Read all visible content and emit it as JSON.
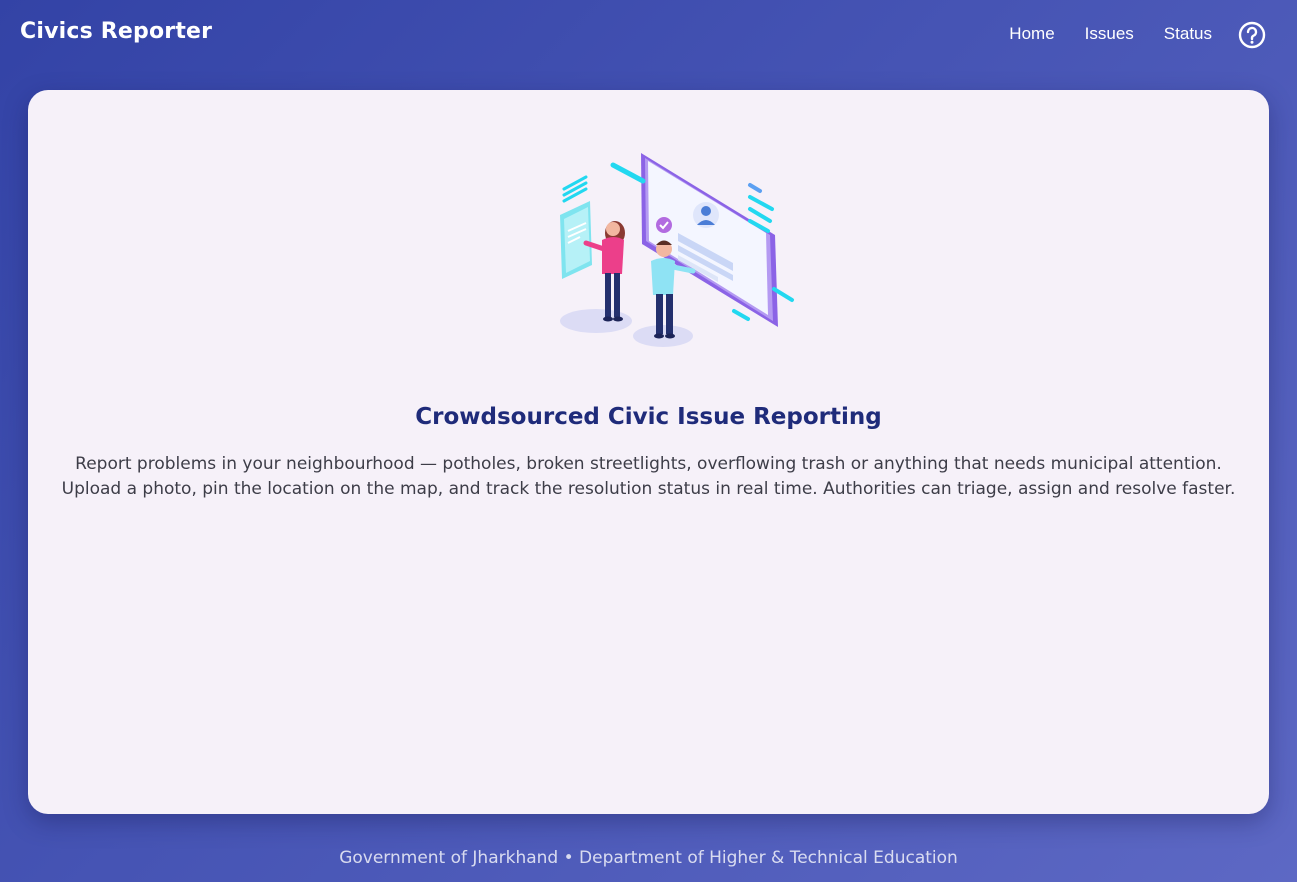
{
  "header": {
    "brand": "Civics Reporter",
    "nav": [
      {
        "label": "Home"
      },
      {
        "label": "Issues"
      },
      {
        "label": "Status"
      }
    ],
    "help_icon": "question-circle-icon"
  },
  "hero": {
    "illustration": "people-reporting-on-screen-illustration",
    "title": "Crowdsourced Civic Issue Reporting",
    "description": "Report problems in your neighbourhood — potholes, broken streetlights, overflowing trash or anything that needs municipal attention. Upload a photo, pin the location on the map, and track the resolution status in real time. Authorities can triage, assign and resolve faster."
  },
  "footer": {
    "text": "Government of Jharkhand • Department of Higher & Technical Education"
  },
  "colors": {
    "background_start": "#3343a6",
    "background_end": "#5d68c4",
    "card": "#f6f1f9",
    "title": "#1f2b7a",
    "body_text": "#3d3d48"
  }
}
